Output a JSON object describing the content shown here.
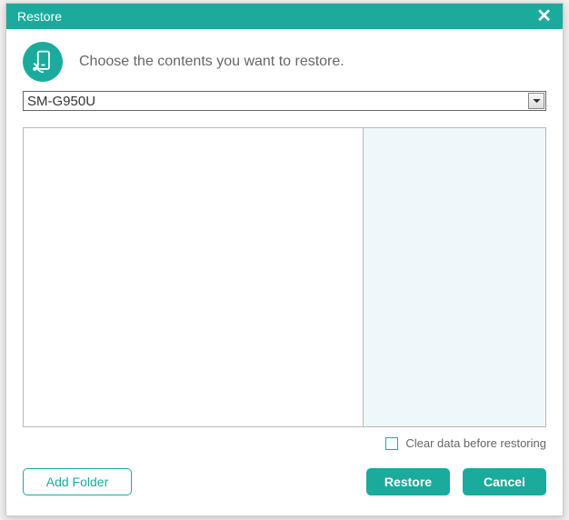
{
  "titlebar": {
    "title": "Restore"
  },
  "header": {
    "text": "Choose the contents you want to restore."
  },
  "dropdown": {
    "selected": "SM-G950U"
  },
  "checkbox": {
    "label": "Clear data before restoring",
    "checked": false
  },
  "buttons": {
    "add_folder": "Add Folder",
    "restore": "Restore",
    "cancel": "Cancel"
  },
  "colors": {
    "accent": "#1aab9c"
  }
}
